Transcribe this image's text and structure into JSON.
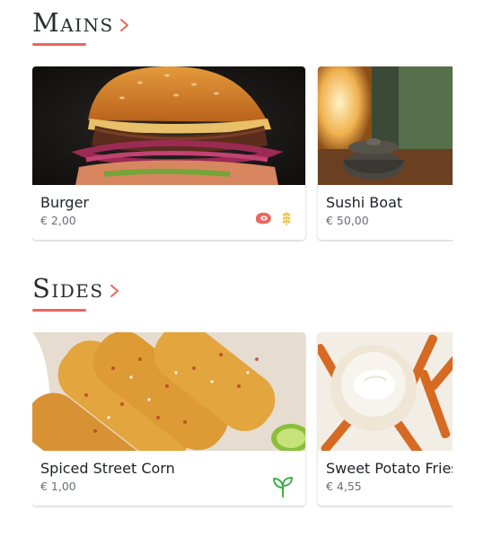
{
  "colors": {
    "accent": "#e8675f",
    "meat_tag": "#e8675f",
    "gluten_tag": "#e8c34a",
    "vegan_tag": "#3fae49"
  },
  "sections": [
    {
      "title": "Mains",
      "items": [
        {
          "name": "Burger",
          "price": "€ 2,00",
          "tags": [
            "meat-icon",
            "gluten-icon"
          ]
        },
        {
          "name": "Sushi Boat",
          "price": "€ 50,00",
          "tags": []
        }
      ]
    },
    {
      "title": "Sides",
      "items": [
        {
          "name": "Spiced Street Corn",
          "price": "€ 1,00",
          "tags": [
            "vegan-sprout-icon"
          ]
        },
        {
          "name": "Sweet Potato Fries",
          "price": "€ 4,55",
          "tags": []
        }
      ]
    }
  ]
}
